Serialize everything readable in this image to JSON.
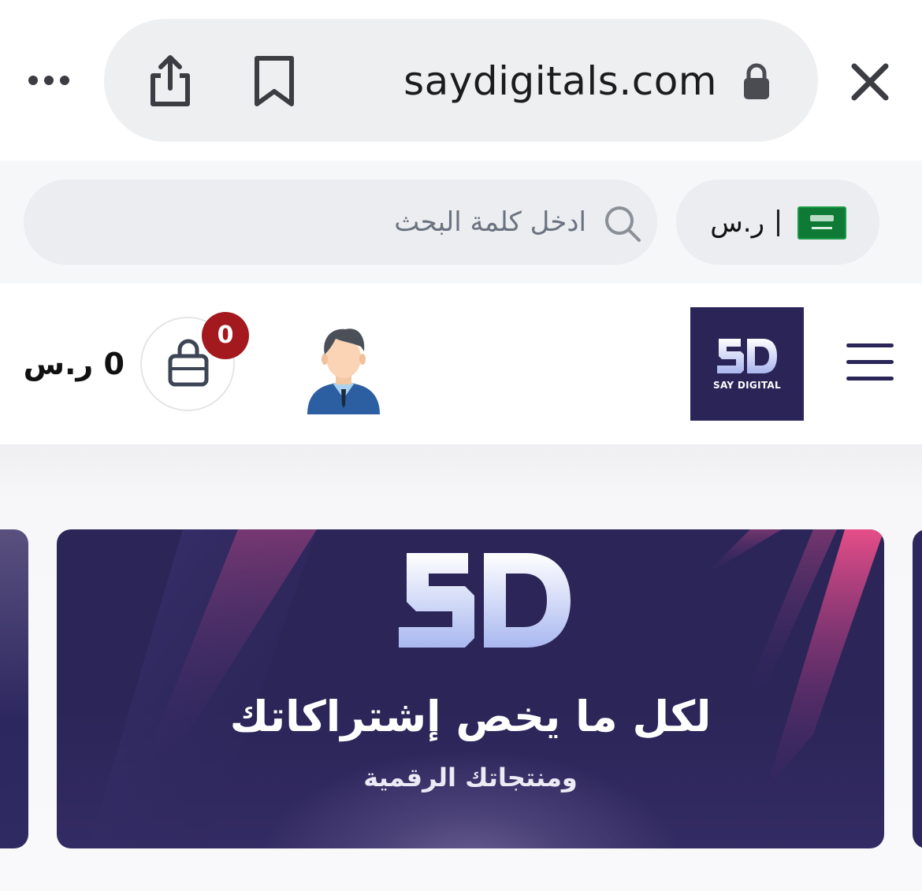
{
  "browser": {
    "url": "saydigitals.com",
    "icons": [
      "more-icon",
      "share-icon",
      "bookmark-icon",
      "lock-icon",
      "close-icon"
    ]
  },
  "search": {
    "placeholder": "ادخل كلمة البحث",
    "icon": "search-icon"
  },
  "currency": {
    "label": "ر.س",
    "flag": "saudi-flag-icon"
  },
  "header": {
    "cart_total": "0 ر.س",
    "cart_count": "0",
    "logo_text": "SAY DIGITAL",
    "logo_mark": "SD",
    "icons": [
      "cart-icon",
      "user-avatar-icon",
      "menu-icon"
    ]
  },
  "banner": {
    "logo_mark": "SD",
    "headline": "لكل ما يخص إشتراكاتك",
    "subtitle": "ومنتجاتك الرقمية"
  },
  "colors": {
    "brand_navy": "#2a2457",
    "accent_pink": "#e8447a",
    "badge_red": "#a3191d",
    "flag_green": "#0f7a35"
  }
}
